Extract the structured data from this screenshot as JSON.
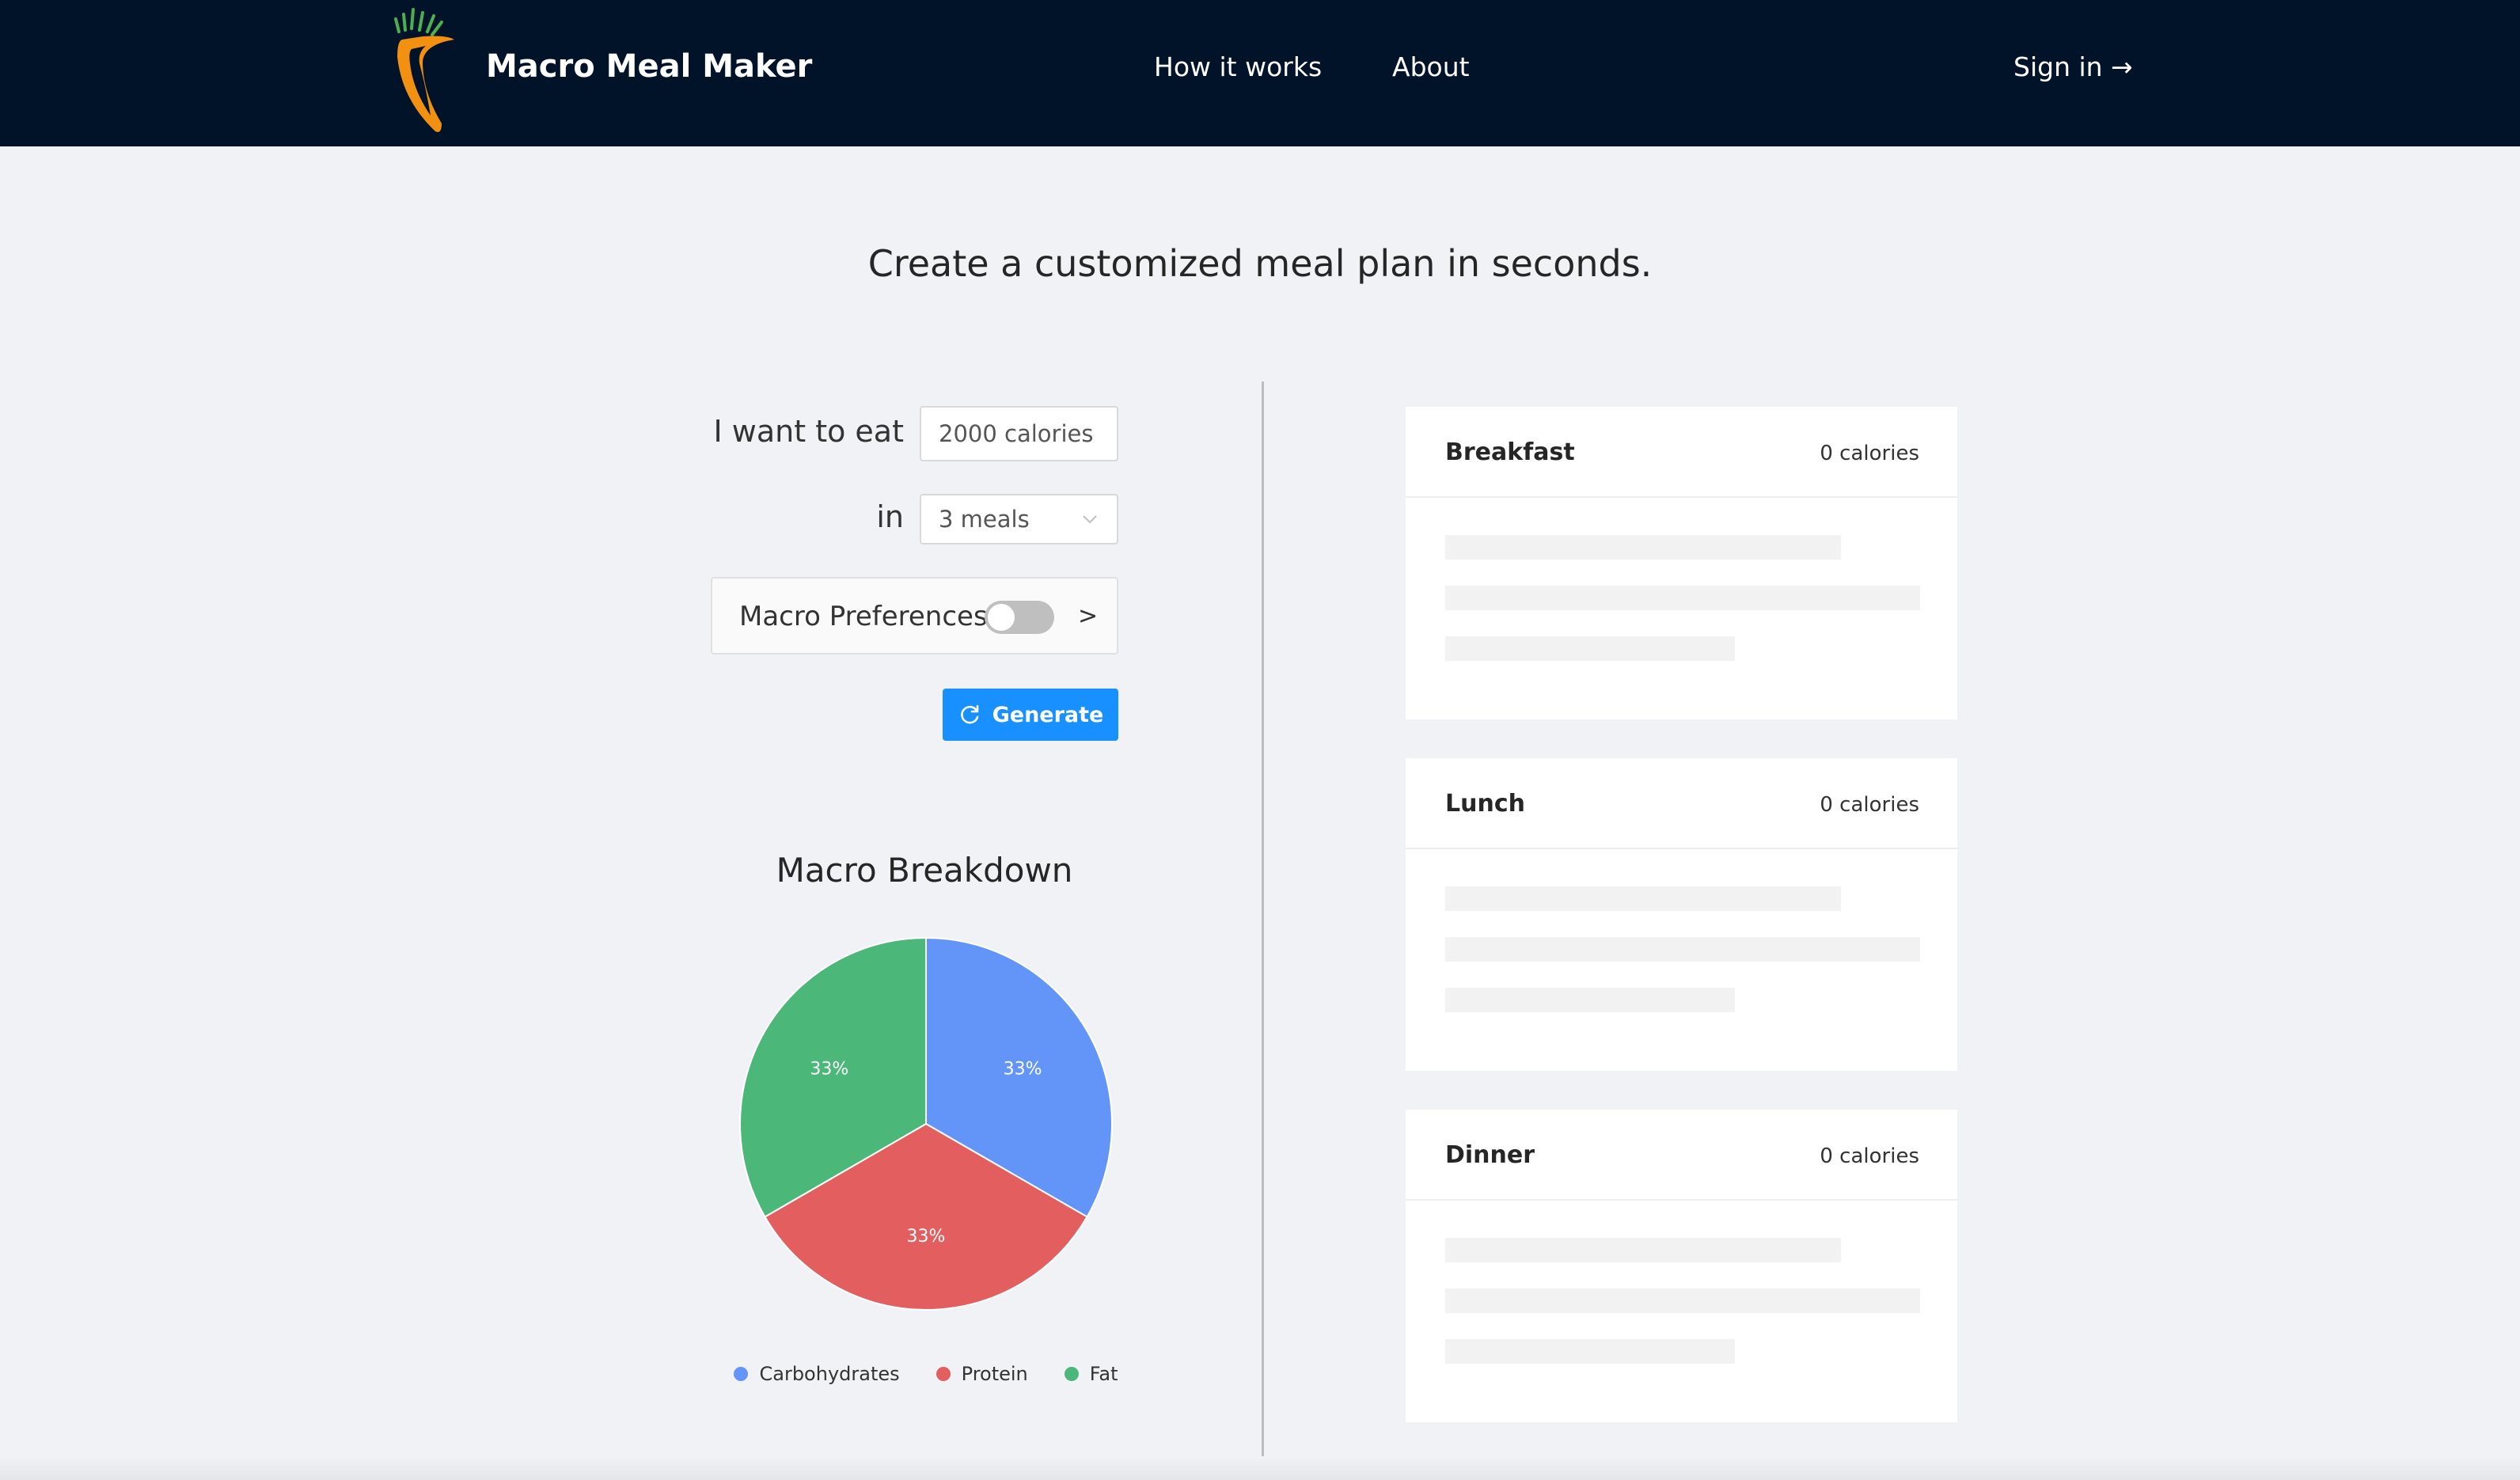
{
  "header": {
    "brand": "Macro Meal Maker",
    "nav": {
      "how_it_works": "How it works",
      "about": "About",
      "sign_in": "Sign in →"
    }
  },
  "tagline": "Create a customized meal plan in seconds.",
  "form": {
    "eat_label": "I want to eat",
    "calories_value": "2000 calories",
    "in_label": "in",
    "meals_value": "3 meals",
    "macro_pref_label": "Macro Preferences",
    "macro_pref_enabled": false,
    "pref_arrow": ">",
    "generate_label": "Generate"
  },
  "chart_data": {
    "type": "pie",
    "title": "Macro Breakdown",
    "categories": [
      "Carbohydrates",
      "Protein",
      "Fat"
    ],
    "values": [
      33,
      33,
      33
    ],
    "labels": [
      "33%",
      "33%",
      "33%"
    ],
    "colors": [
      "#6395f9",
      "#e35f5f",
      "#4bb87a"
    ],
    "legend": "bottom"
  },
  "meals": [
    {
      "name": "Breakfast",
      "calories": "0 calories"
    },
    {
      "name": "Lunch",
      "calories": "0 calories"
    },
    {
      "name": "Dinner",
      "calories": "0 calories"
    }
  ],
  "colors": {
    "header_bg": "#011328",
    "primary": "#1890ff",
    "page_bg": "#f0f2f5"
  }
}
